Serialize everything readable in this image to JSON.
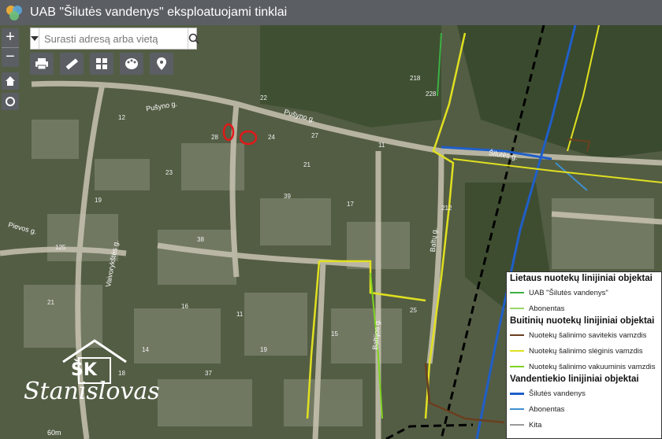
{
  "app": {
    "title": "UAB \"Šilutės vandenys\" eksploatuojami tinklai"
  },
  "search": {
    "placeholder": "Surasti adresą arba vietą"
  },
  "map": {
    "scale_label": "60m",
    "street_labels": [
      "Pušyno g.",
      "Pušyno g.",
      "Vaivorykštės g.",
      "Šilutės g.",
      "Baltijos g.",
      "Baltų g.",
      "Pievos g."
    ],
    "parcel_numbers": [
      "12",
      "28",
      "22",
      "24",
      "218",
      "228",
      "212",
      "21",
      "27",
      "11",
      "23",
      "39",
      "17",
      "38",
      "19",
      "125",
      "16",
      "11",
      "14",
      "19",
      "15",
      "37",
      "25",
      "18",
      "21"
    ]
  },
  "legend": {
    "sections": [
      {
        "title": "Lietaus nuotekų linijiniai objektai",
        "items": [
          {
            "label": "UAB \"Šilutės vandenys\"",
            "color": "#3cb043"
          },
          {
            "label": "Abonentas",
            "color": "#9ad66a"
          }
        ]
      },
      {
        "title": "Buitinių nuotekų linijiniai objektai",
        "items": [
          {
            "label": "Nuotekų šalinimo savitekis vamzdis",
            "color": "#6b3f1f"
          },
          {
            "label": "Nuotekų šalinimo slėginis vamzdis",
            "color": "#e0e020"
          },
          {
            "label": "Nuotekų šalinimo vakuuminis vamzdis",
            "color": "#7ed321"
          }
        ]
      },
      {
        "title": "Vandentiekio linijiniai objektai",
        "items": [
          {
            "label": "Šilutės vandenys",
            "color": "#1f5fc9"
          },
          {
            "label": "Abonentas",
            "color": "#3e8fd0"
          },
          {
            "label": "Kita",
            "color": "#999999"
          }
        ]
      }
    ]
  },
  "watermark": {
    "brand": "Stanislovas",
    "letters": "ŠK"
  }
}
